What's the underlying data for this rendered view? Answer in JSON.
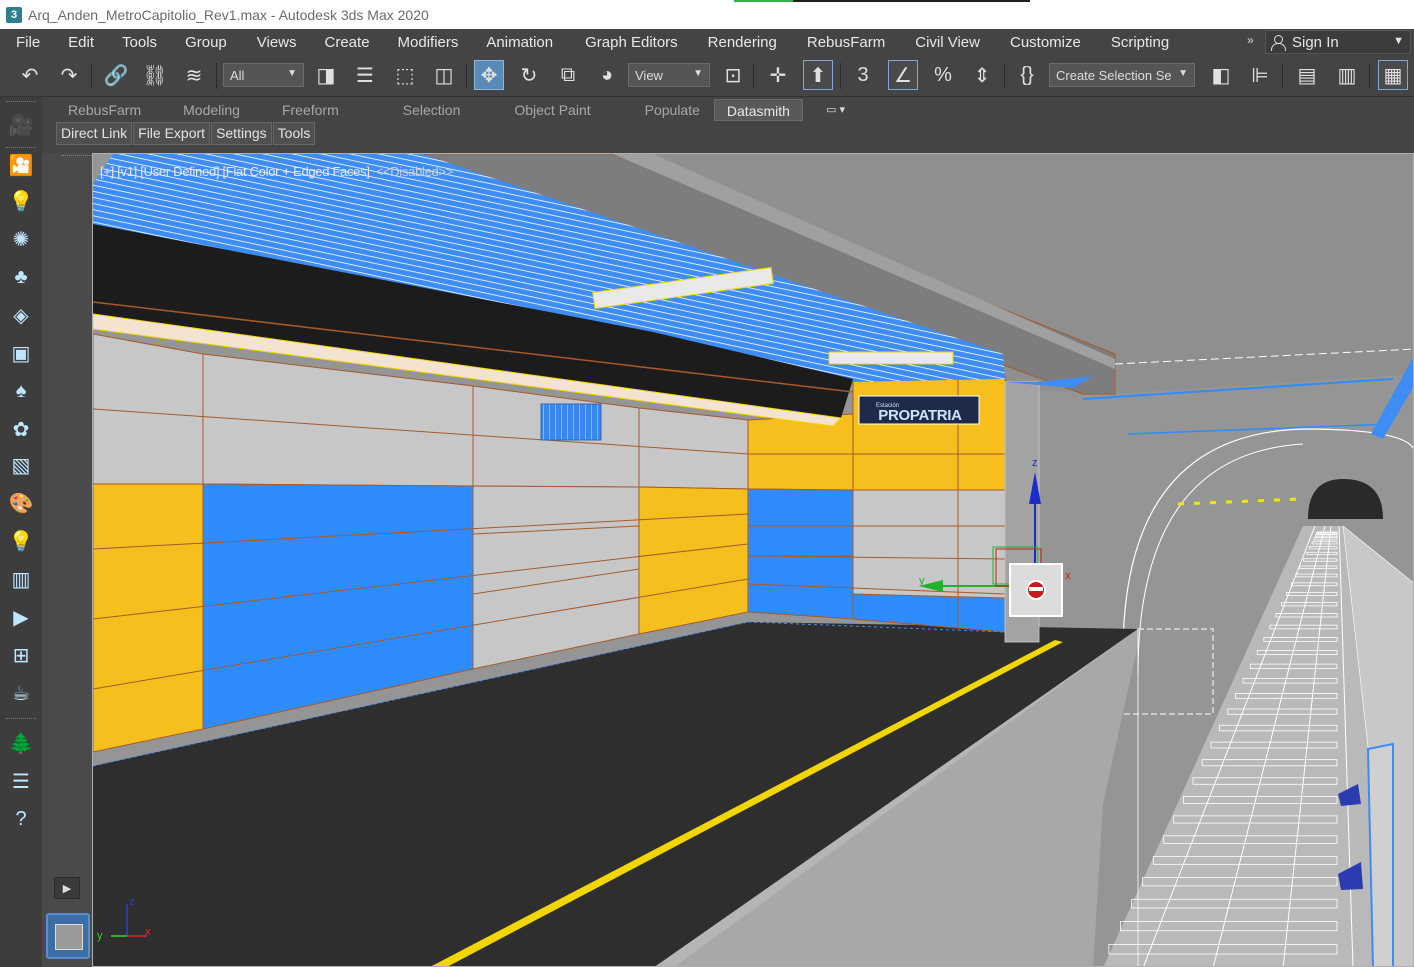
{
  "window": {
    "title": "Arq_Anden_MetroCapitolio_Rev1.max - Autodesk 3ds Max 2020",
    "app_icon": "3",
    "progress_fraction": 0.2
  },
  "menubar": {
    "items": [
      "File",
      "Edit",
      "Tools",
      "Group",
      "Views",
      "Create",
      "Modifiers",
      "Animation",
      "Graph Editors",
      "Rendering",
      "RebusFarm",
      "Civil View",
      "Customize",
      "Scripting"
    ],
    "more": "»",
    "sign_in": "Sign In"
  },
  "toolbar": {
    "selection_filter": "All",
    "reference_coord": "View",
    "named_selection": "Create Selection Se",
    "percent_snap": "%",
    "angle_snap": "3"
  },
  "ribbon": {
    "tabs": [
      "RebusFarm",
      "Modeling",
      "Freeform",
      "Selection",
      "Object Paint",
      "Populate",
      "Datasmith"
    ],
    "active_tab": "Datasmith",
    "subtabs": [
      "Direct Link",
      "File Export",
      "Settings",
      "Tools"
    ]
  },
  "viewport": {
    "label": "[+] [v1] [User Defined] [Flat Color + Edged Faces]",
    "disabled": "<<Disabled>>",
    "sign_small": "Estación",
    "sign_text": "PROPATRIA",
    "gizmo_labels": {
      "x": "x",
      "y": "y",
      "z": "z"
    },
    "axis_labels": {
      "x": "x",
      "y": "y",
      "z": "z"
    }
  },
  "colors": {
    "wall_yellow": "#f7bf1e",
    "wall_blue": "#2f8cff",
    "wall_grey": "#c7c7c7",
    "platform": "#2e2e2e",
    "safety_line": "#f2d600",
    "tunnel": "#939393",
    "wire": "#ffffff"
  }
}
